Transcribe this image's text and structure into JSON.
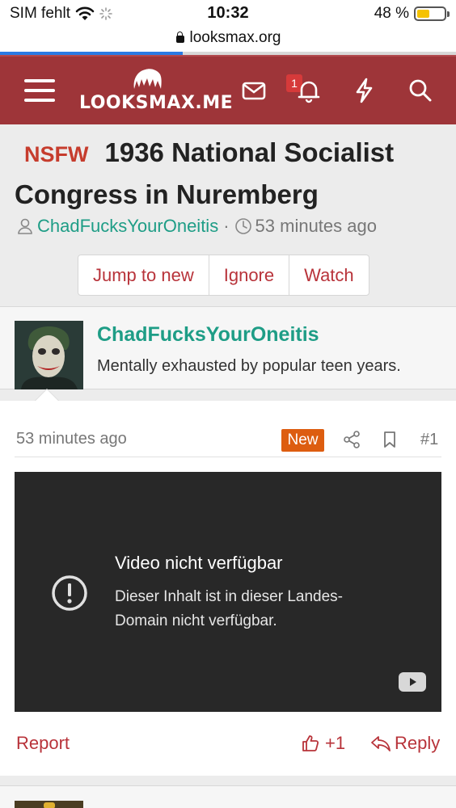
{
  "status_bar": {
    "carrier": "SIM fehlt",
    "time": "10:32",
    "battery_percent": "48 %",
    "battery_level": 0.48
  },
  "browser": {
    "url": "looksmax.org",
    "load_progress": 0.4
  },
  "header": {
    "logo_text": "LOOKSMAX.ME",
    "notification_count": "1",
    "accent_color": "#9e3539",
    "icons": [
      "menu-icon",
      "mail-icon",
      "bell-icon",
      "bolt-icon",
      "search-icon"
    ]
  },
  "thread": {
    "prefix": "NSFW",
    "title": "1936 National Socialist Congress in Nuremberg",
    "author": "ChadFucksYourOneitis",
    "separator": "·",
    "time_ago": "53 minutes ago",
    "buttons": {
      "jump": "Jump to new",
      "ignore": "Ignore",
      "watch": "Watch"
    }
  },
  "user": {
    "name": "ChadFucksYourOneitis",
    "user_title": "Mentally exhausted by popular teen years."
  },
  "post": {
    "time_ago": "53 minutes ago",
    "new_label": "New",
    "number": "#1",
    "video": {
      "title": "Video nicht verfügbar",
      "message": "Dieser Inhalt ist in dieser Landes-Domain nicht verfügbar."
    },
    "report_label": "Report",
    "reaction_count": "+1",
    "reply_label": "Reply"
  }
}
